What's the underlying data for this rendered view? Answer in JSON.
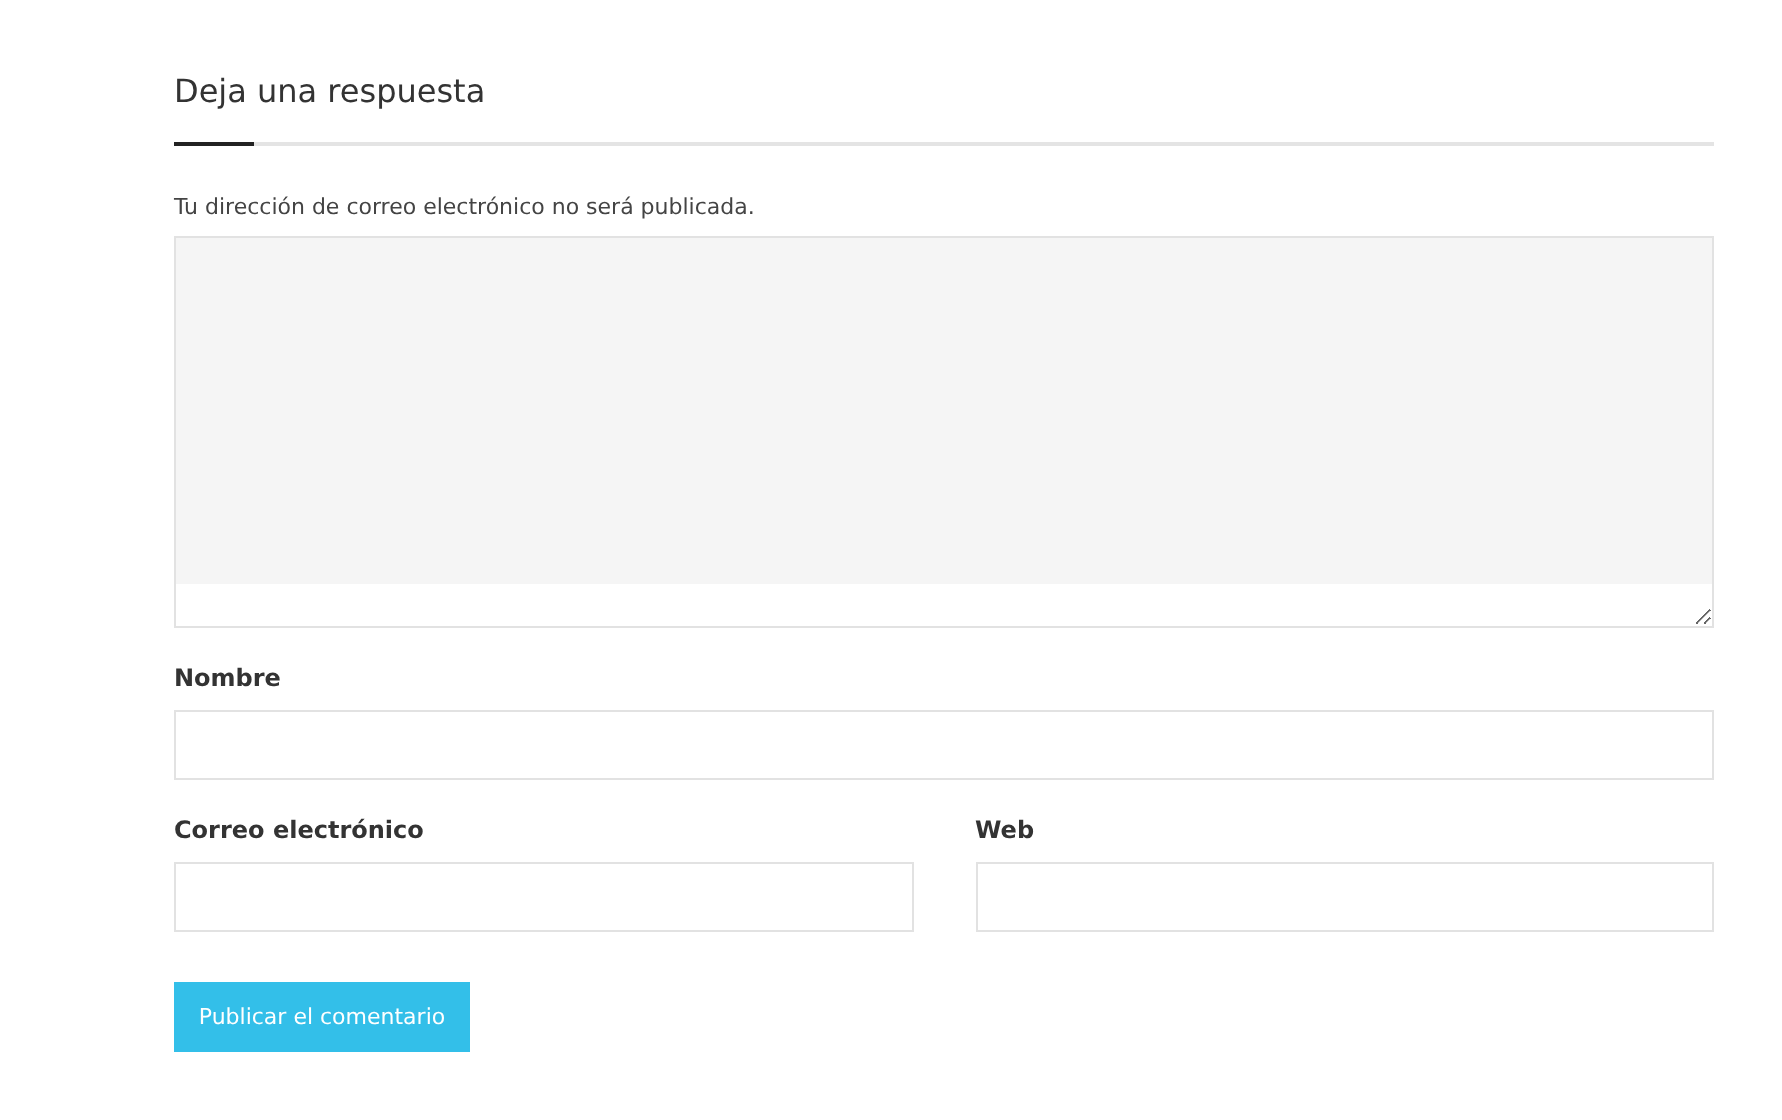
{
  "heading": "Deja una respuesta",
  "notice": "Tu dirección de correo electrónico no será publicada.",
  "comment_field": {
    "resizable": true
  },
  "field_rows": [
    [
      {
        "label": "Nombre"
      }
    ],
    [
      {
        "label": "Correo electrónico"
      },
      {
        "label": "Web"
      }
    ]
  ],
  "submit_button": "Publicar el comentario"
}
